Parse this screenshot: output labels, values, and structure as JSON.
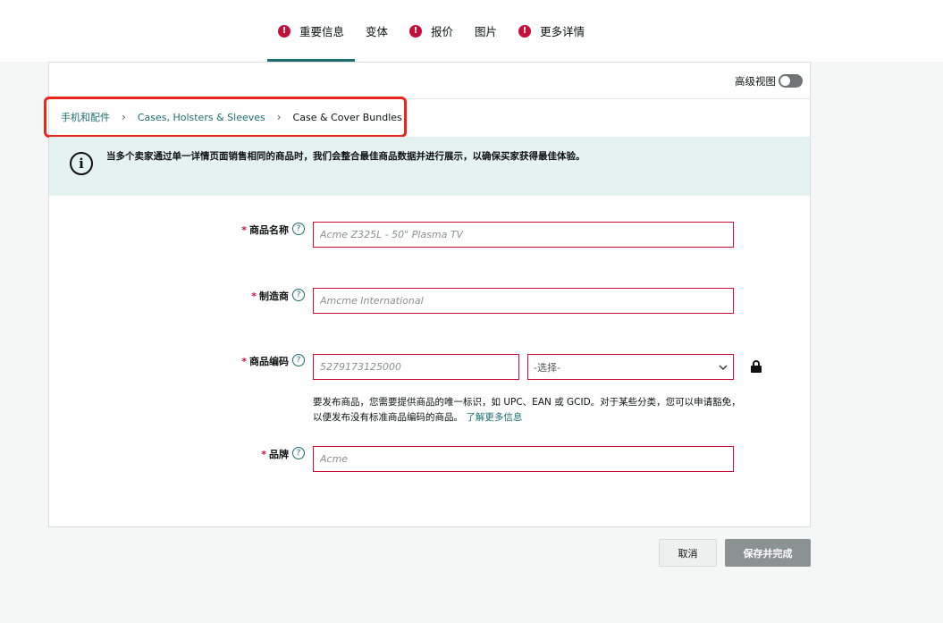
{
  "tabs": [
    {
      "label": "重要信息",
      "error": true,
      "active": true
    },
    {
      "label": "变体",
      "error": false,
      "active": false
    },
    {
      "label": "报价",
      "error": true,
      "active": false
    },
    {
      "label": "图片",
      "error": false,
      "active": false
    },
    {
      "label": "更多详情",
      "error": true,
      "active": false
    }
  ],
  "advanced_view": {
    "label": "高级视图",
    "enabled": false
  },
  "breadcrumb": {
    "items": [
      "手机和配件",
      "Cases, Holsters & Sleeves",
      "Case & Cover Bundles"
    ],
    "separator": "›"
  },
  "info": {
    "icon": "info-icon",
    "text": "当多个卖家通过单一详情页面销售相同的商品时，我们会整合最佳商品数据并进行展示，以确保买家获得最佳体验。"
  },
  "fields": {
    "product_name": {
      "label": "商品名称",
      "required_mark": "*",
      "placeholder": "Acme Z325L - 50\" Plasma TV",
      "value": ""
    },
    "manufacturer": {
      "label": "制造商",
      "required_mark": "*",
      "placeholder": "Amcme International",
      "value": ""
    },
    "product_id": {
      "label": "商品编码",
      "required_mark": "*",
      "placeholder": "5279173125000",
      "value": "",
      "type_selected": "-选择-"
    },
    "brand": {
      "label": "品牌",
      "required_mark": "*",
      "placeholder": "Acme",
      "value": ""
    }
  },
  "product_id_help": {
    "text": "要发布商品，您需要提供商品的唯一标识，如 UPC、EAN 或 GCID。对于某些分类，您可以申请豁免，以便发布没有标准商品编码的商品。",
    "link": "了解更多信息"
  },
  "help_glyph": "?",
  "error_glyph": "!",
  "info_glyph": "i",
  "buttons": {
    "cancel": "取消",
    "save": "保存并完成"
  },
  "colors": {
    "accent": "#1d6d70",
    "error": "#c40f3a",
    "highlight": "#e8261c",
    "info_bg": "#e5f2f2"
  }
}
